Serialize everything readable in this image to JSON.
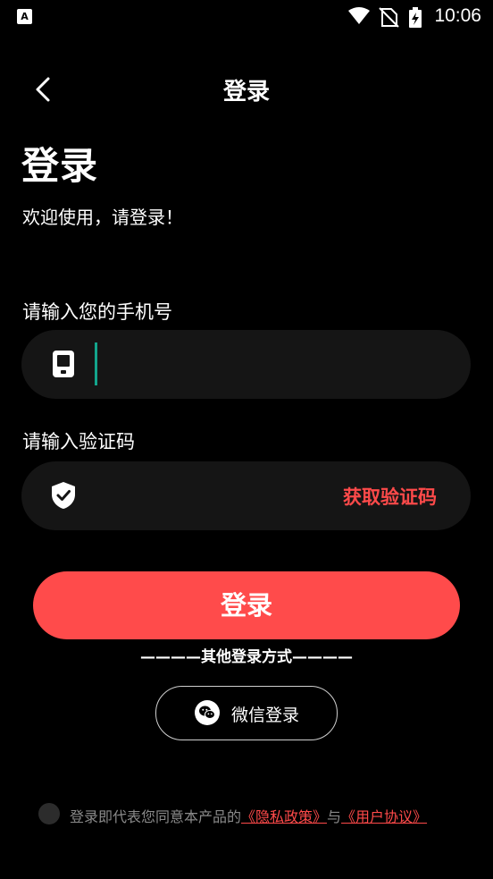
{
  "status_bar": {
    "app_icon_letter": "A",
    "time": "10:06",
    "icons": [
      "wifi-icon",
      "no-sim-icon",
      "battery-charging-icon"
    ]
  },
  "header": {
    "title": "登录"
  },
  "page": {
    "title": "登录",
    "welcome": "欢迎使用，请登录！"
  },
  "phone": {
    "label": "请输入您的手机号",
    "value": "",
    "placeholder": ""
  },
  "code": {
    "label": "请输入验证码",
    "value": "",
    "placeholder": "",
    "get_code_label": "获取验证码"
  },
  "login_button": "登录",
  "other_methods": "————其他登录方式————",
  "wechat_login": "微信登录",
  "agreement": {
    "prefix": "登录即代表您同意本产品的",
    "privacy_link": "《隐私政策》",
    "middle": "与",
    "terms_link": "《用户协议》"
  },
  "colors": {
    "accent": "#ff4b4b",
    "caret": "#13a58c",
    "field_bg": "#151515",
    "background": "#000000"
  }
}
